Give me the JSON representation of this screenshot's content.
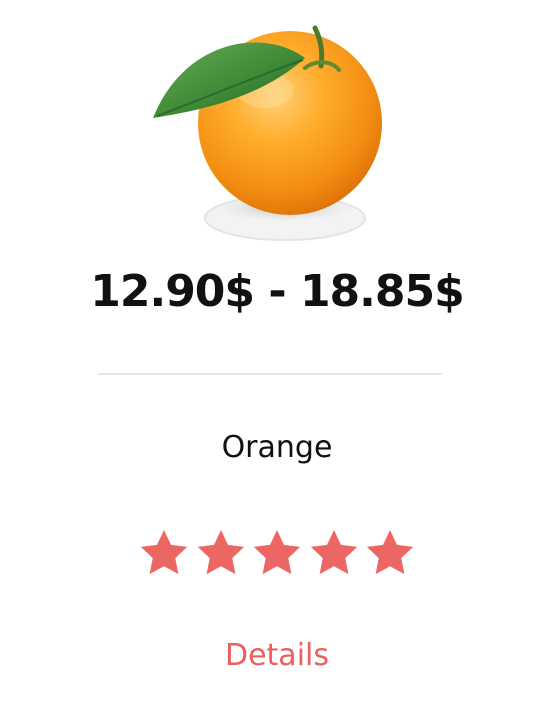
{
  "product": {
    "price": "12.90$ - 18.85$",
    "name": "Orange",
    "rating": {
      "value": 5,
      "max": 5
    },
    "details_label": "Details",
    "image_icon": "orange-fruit-icon"
  },
  "colors": {
    "accent": "#e8605f",
    "star": "#ec6664",
    "text": "#111111",
    "divider": "#e6e6e6"
  }
}
